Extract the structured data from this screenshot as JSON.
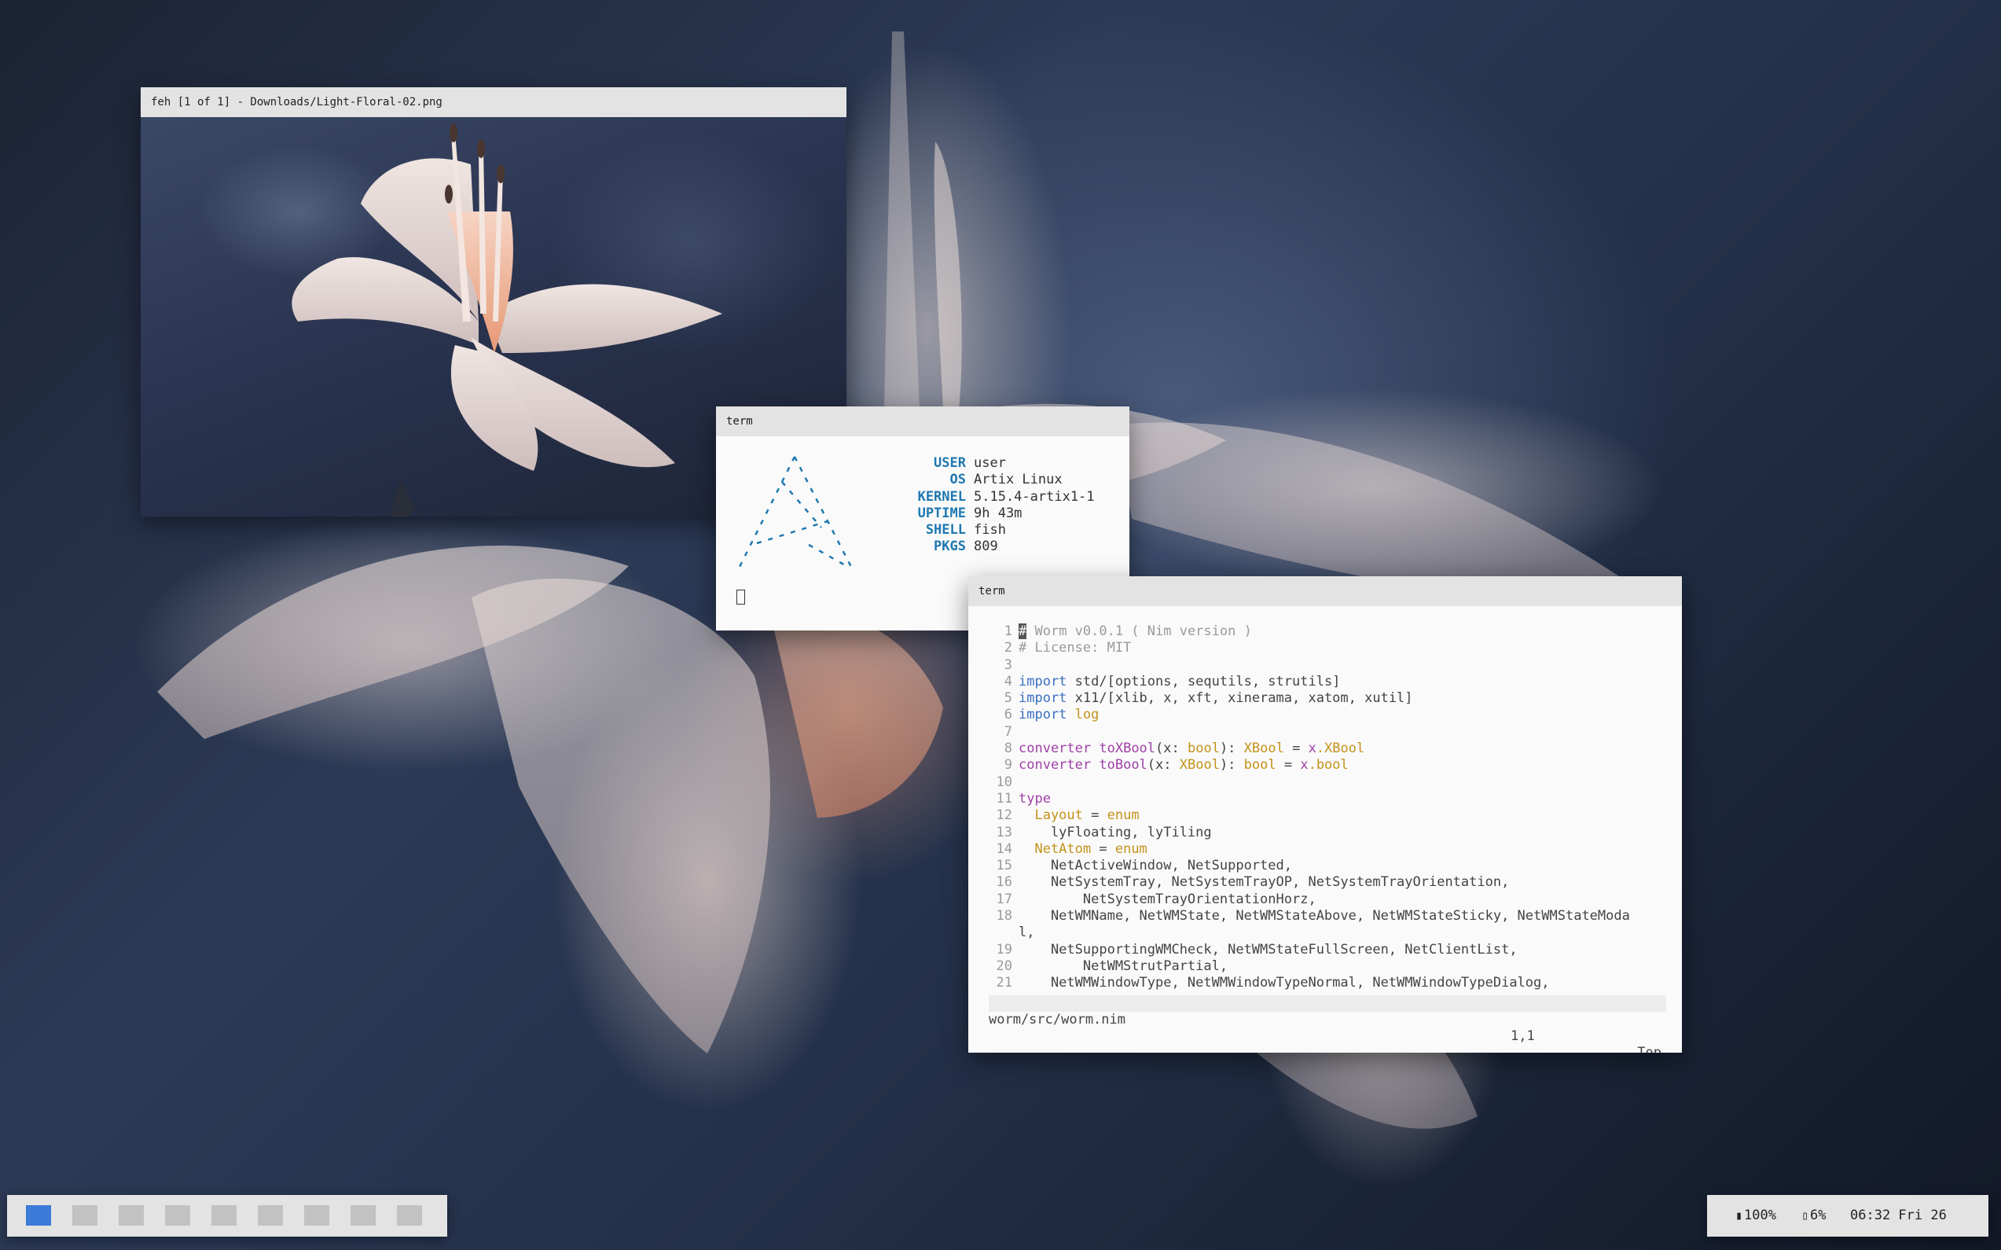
{
  "feh": {
    "title": "feh [1 of 1] - Downloads/Light-Floral-02.png"
  },
  "neofetch": {
    "title": "term",
    "info": [
      {
        "key": "USER",
        "value": "user"
      },
      {
        "key": "OS",
        "value": "Artix Linux"
      },
      {
        "key": "KERNEL",
        "value": "5.15.4-artix1-1"
      },
      {
        "key": "UPTIME",
        "value": "9h 43m"
      },
      {
        "key": "SHELL",
        "value": "fish"
      },
      {
        "key": "PKGS",
        "value": "809"
      }
    ],
    "logo_color": "#1e78b0"
  },
  "editor": {
    "title": "term",
    "lines": [
      {
        "n": "1",
        "segs": [
          {
            "c": "cur",
            "t": "#"
          },
          {
            "c": "cm",
            "t": " Worm v0.0.1 ( Nim version )"
          }
        ]
      },
      {
        "n": "2",
        "segs": [
          {
            "c": "cm",
            "t": "# License: MIT"
          }
        ]
      },
      {
        "n": "3",
        "segs": []
      },
      {
        "n": "4",
        "segs": [
          {
            "c": "kw",
            "t": "import"
          },
          {
            "c": "tx",
            "t": " std/[options, sequtils, strutils]"
          }
        ]
      },
      {
        "n": "5",
        "segs": [
          {
            "c": "kw",
            "t": "import"
          },
          {
            "c": "tx",
            "t": " x11/[xlib, x, xft, xinerama, xatom, xutil]"
          }
        ]
      },
      {
        "n": "6",
        "segs": [
          {
            "c": "kw",
            "t": "import"
          },
          {
            "c": "ty",
            "t": " log"
          }
        ]
      },
      {
        "n": "7",
        "segs": []
      },
      {
        "n": "8",
        "segs": [
          {
            "c": "fn",
            "t": "converter"
          },
          {
            "c": "tx",
            "t": " "
          },
          {
            "c": "fn",
            "t": "toXBool"
          },
          {
            "c": "tx",
            "t": "(x: "
          },
          {
            "c": "ty",
            "t": "bool"
          },
          {
            "c": "tx",
            "t": "): "
          },
          {
            "c": "ty",
            "t": "XBool"
          },
          {
            "c": "tx",
            "t": " = "
          },
          {
            "c": "op",
            "t": "x"
          },
          {
            "c": "ty",
            "t": ".XBool"
          }
        ]
      },
      {
        "n": "9",
        "segs": [
          {
            "c": "fn",
            "t": "converter"
          },
          {
            "c": "tx",
            "t": " "
          },
          {
            "c": "fn",
            "t": "toBool"
          },
          {
            "c": "tx",
            "t": "(x: "
          },
          {
            "c": "ty",
            "t": "XBool"
          },
          {
            "c": "tx",
            "t": "): "
          },
          {
            "c": "ty",
            "t": "bool"
          },
          {
            "c": "tx",
            "t": " = "
          },
          {
            "c": "op",
            "t": "x"
          },
          {
            "c": "ty",
            "t": ".bool"
          }
        ]
      },
      {
        "n": "10",
        "segs": []
      },
      {
        "n": "11",
        "segs": [
          {
            "c": "fn",
            "t": "type"
          }
        ]
      },
      {
        "n": "12",
        "segs": [
          {
            "c": "ty",
            "t": "  Layout"
          },
          {
            "c": "tx",
            "t": " = "
          },
          {
            "c": "ty",
            "t": "enum"
          }
        ]
      },
      {
        "n": "13",
        "segs": [
          {
            "c": "tx",
            "t": "    lyFloating, lyTiling"
          }
        ]
      },
      {
        "n": "14",
        "segs": [
          {
            "c": "ty",
            "t": "  NetAtom"
          },
          {
            "c": "tx",
            "t": " = "
          },
          {
            "c": "ty",
            "t": "enum"
          }
        ]
      },
      {
        "n": "15",
        "segs": [
          {
            "c": "tx",
            "t": "    NetActiveWindow, NetSupported,"
          }
        ]
      },
      {
        "n": "16",
        "segs": [
          {
            "c": "tx",
            "t": "    NetSystemTray, NetSystemTrayOP, NetSystemTrayOrientation,"
          }
        ]
      },
      {
        "n": "17",
        "segs": [
          {
            "c": "tx",
            "t": "        NetSystemTrayOrientationHorz,"
          }
        ]
      },
      {
        "n": "18",
        "segs": [
          {
            "c": "tx",
            "t": "    NetWMName, NetWMState, NetWMStateAbove, NetWMStateSticky, NetWMStateModa"
          }
        ]
      },
      {
        "n": "",
        "segs": [
          {
            "c": "tx",
            "t": "l,"
          }
        ]
      },
      {
        "n": "19",
        "segs": [
          {
            "c": "tx",
            "t": "    NetSupportingWMCheck, NetWMStateFullScreen, NetClientList,"
          }
        ]
      },
      {
        "n": "20",
        "segs": [
          {
            "c": "tx",
            "t": "        NetWMStrutPartial,"
          }
        ]
      },
      {
        "n": "21",
        "segs": [
          {
            "c": "tx",
            "t": "    NetWMWindowType, NetWMWindowTypeNormal, NetWMWindowTypeDialog,"
          }
        ]
      }
    ],
    "status": {
      "file": "worm/src/worm.nim",
      "position": "1,1",
      "scroll": "Top"
    }
  },
  "bar": {
    "workspaces": [
      {
        "id": "1",
        "active": true
      },
      {
        "id": "2",
        "active": false
      },
      {
        "id": "3",
        "active": false
      },
      {
        "id": "4",
        "active": false
      },
      {
        "id": "5",
        "active": false
      },
      {
        "id": "6",
        "active": false
      },
      {
        "id": "7",
        "active": false
      },
      {
        "id": "8",
        "active": false
      },
      {
        "id": "9",
        "active": false
      }
    ],
    "active_color": "#3a7ad8",
    "battery": "100%",
    "memory": "6%",
    "clock": "06:32 Fri 26",
    "icons": {
      "battery": "battery-icon",
      "memory": "memory-icon"
    }
  }
}
